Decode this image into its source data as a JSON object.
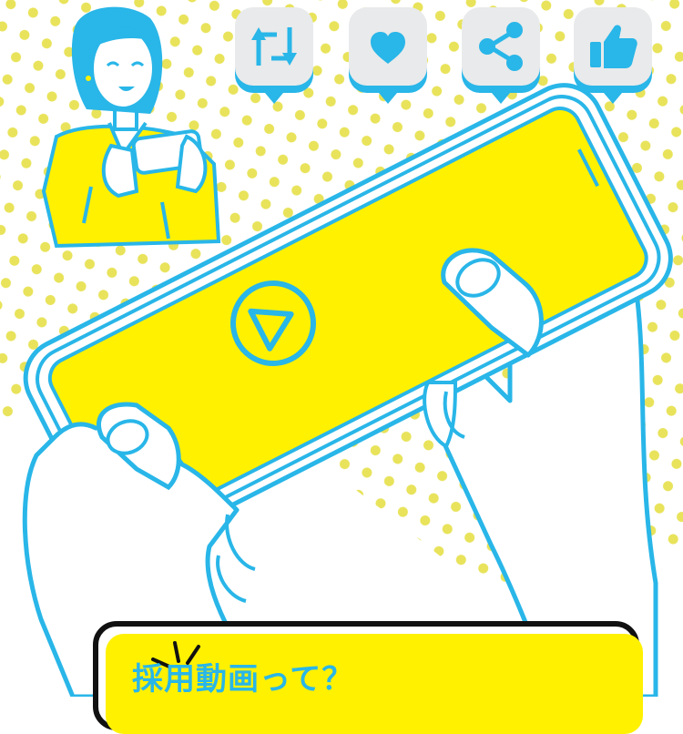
{
  "scene": {
    "colors": {
      "yellow": "#fff100",
      "cyan": "#29b6e8",
      "dot": "#e8e35a",
      "ink": "#111111",
      "button_bg": "#e9eaeb"
    }
  },
  "reactions": [
    {
      "name": "repost",
      "icon": "repost-icon"
    },
    {
      "name": "like",
      "icon": "heart-icon"
    },
    {
      "name": "share",
      "icon": "share-icon"
    },
    {
      "name": "thumbs-up",
      "icon": "thumbs-up-icon"
    }
  ],
  "phone": {
    "icon": "play-icon"
  },
  "callout": {
    "title": "採用動画って？"
  }
}
